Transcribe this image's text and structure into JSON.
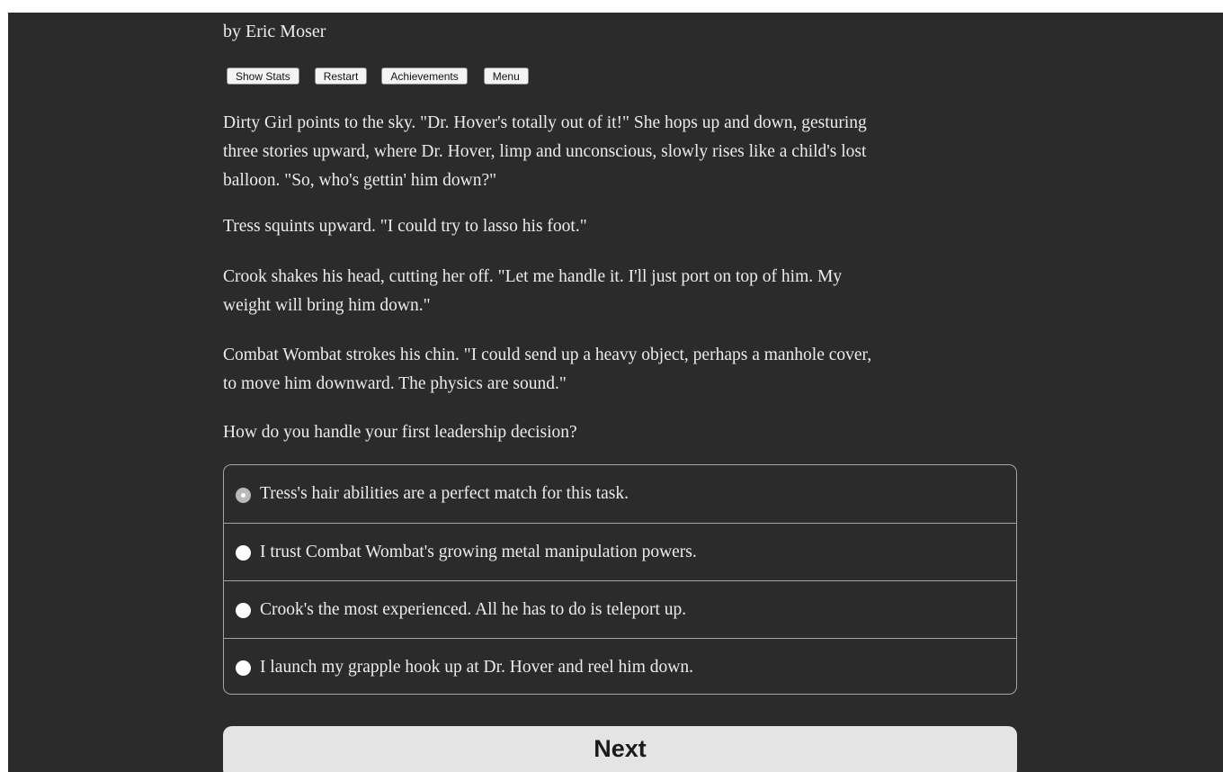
{
  "header": {
    "author": "by Eric Moser"
  },
  "toolbar": {
    "show_stats": "Show Stats",
    "restart": "Restart",
    "achievements": "Achievements",
    "menu": "Menu"
  },
  "story": {
    "paragraphs": [
      [
        "Dirty Girl points to the sky. \"Dr. Hover's totally out of it!\" She hops up and down, gesturing",
        "three stories upward, where Dr. Hover, limp and unconscious, slowly rises like a child's lost",
        "balloon. \"So, who's gettin' him down?\""
      ],
      [
        "Tress squints upward. \"I could try to lasso his foot.\""
      ],
      [
        "Crook shakes his head, cutting her off. \"Let me handle it. I'll just port on top of him. My",
        "weight will bring him down.\""
      ],
      [
        "Combat Wombat strokes his chin. \"I could send up a heavy object, perhaps a manhole cover,",
        "to move him downward. The physics are sound.\""
      ],
      [
        "How do you handle your first leadership decision?"
      ]
    ]
  },
  "choices": {
    "selected_index": 0,
    "options": [
      "Tress's hair abilities are a perfect match for this task.",
      "I trust Combat Wombat's growing metal manipulation powers.",
      "Crook's the most experienced. All he has to do is teleport up.",
      "I launch my grapple hook up at Dr. Hover and reel him down."
    ]
  },
  "next_button": {
    "label": "Next"
  }
}
